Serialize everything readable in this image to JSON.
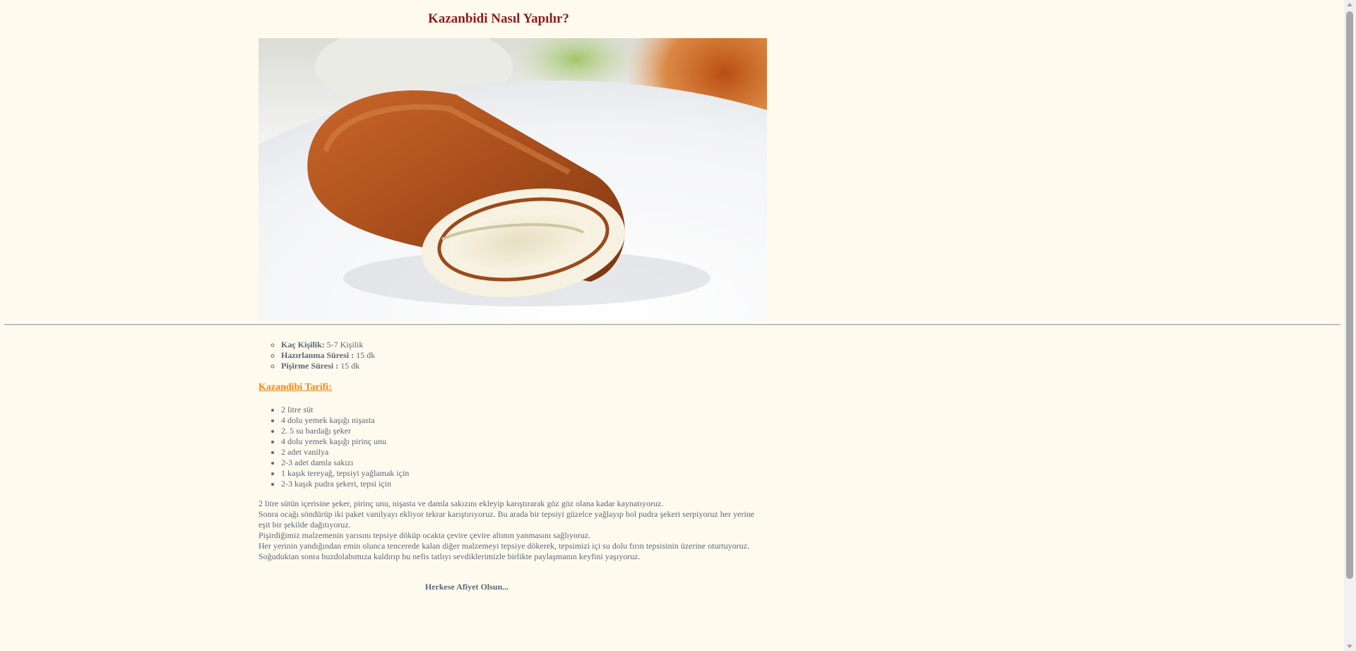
{
  "title": "Kazanbidi Nasıl Yapılır?",
  "hero_image": {
    "icon": "kazandibi-photo"
  },
  "info": [
    {
      "label": "Kaç Kişilik:",
      "value": " 5-7 Kişilik"
    },
    {
      "label": "Hazırlanma Süresi :",
      "value": " 15 dk"
    },
    {
      "label": "Pişirme Süresi :",
      "value": " 15 dk"
    }
  ],
  "recipe_heading": "Kazandibi Tarifi:",
  "ingredients": [
    "2 litre süt",
    "4 dolu yemek kaşığı nişasta",
    "2. 5 su bardağı şeker",
    "4 dolu yemek kaşığı pirinç unu",
    "2 adet vanilya",
    "2-3 adet damla sakızı",
    "1 kaşık tereyağ, tepsiyi yağlamak için",
    "2-3 kaşık pudra şekeri, tepsi için"
  ],
  "instructions": [
    "2 litre sütün içerisine şeker, pirinç unu, nişasta ve damla sakızını ekleyip karıştırarak göz göz olana kadar kaynatıyoruz.",
    "Sonra ocağı söndürüp iki paket vanilyayı ekliyor tekrar karıştırıyoruz. Bu arada bir tepsiyi güzelce yağlayıp bol pudra şekeri serpiyoruz her yerine eşit bir şekilde dağıtıyoruz.",
    "Pişirdiğimiz malzemenin yarısını tepsiye döküp ocakta çevire çevire altının yanmasını sağlıyoruz.",
    "Her yerinin yandığından emin olunca tencerede kalan diğer malzemeyi tepsiye dökerek, tepsimizi içi su dolu fırın tepsisinin üzerine oturtuyoruz.",
    "Soğuduktan sonra buzdolabımıza kaldırıp bu nefis tatlıyı sevdiklerimizle birlikte paylaşmanın keyfini yaşıyoruz."
  ],
  "closing": "Herkese Afiyet Olsun...",
  "colors": {
    "background": "#fffaee",
    "title": "#8e1c1c",
    "heading": "#f08a12",
    "text": "#5a6878"
  }
}
